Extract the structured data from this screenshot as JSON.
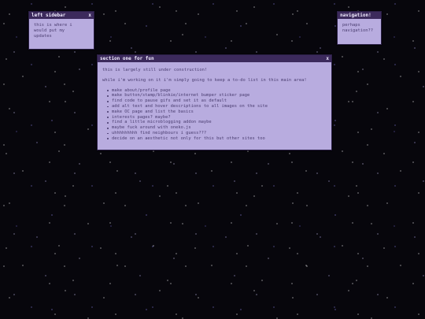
{
  "colors": {
    "background": "#07060c",
    "titlebar": "#3c2a5c",
    "titlebar_text": "#f1ecff",
    "window_body": "#b8acdf",
    "body_text": "#4a3d70"
  },
  "left_sidebar": {
    "title": "left sidebar",
    "close_label": "x",
    "text": "this is where i would put my updates"
  },
  "navigation": {
    "title": "navigation!",
    "text": "perhaps navigation??"
  },
  "main": {
    "title": "section one for fun",
    "close_label": "x",
    "intro": "this is largely still under construction!",
    "lead": "while i'm working on it i'm simply going to keep a to-do list in this main area!",
    "todo": [
      "make about/profile page",
      "make button/stamp/blinkie/internet bumper sticker page",
      "find code to pause gifs and set it as default",
      "add alt text and hover descriptions to all images on the site",
      "make OC page and list the basics",
      "interests pages? maybe?",
      "find a little microblogging addon maybe",
      "maybe fuck around with oneko.js",
      "uhhhhhhhhh find neighbours i guess???",
      "decide on an aesthetic not only for this but other sites too"
    ]
  }
}
